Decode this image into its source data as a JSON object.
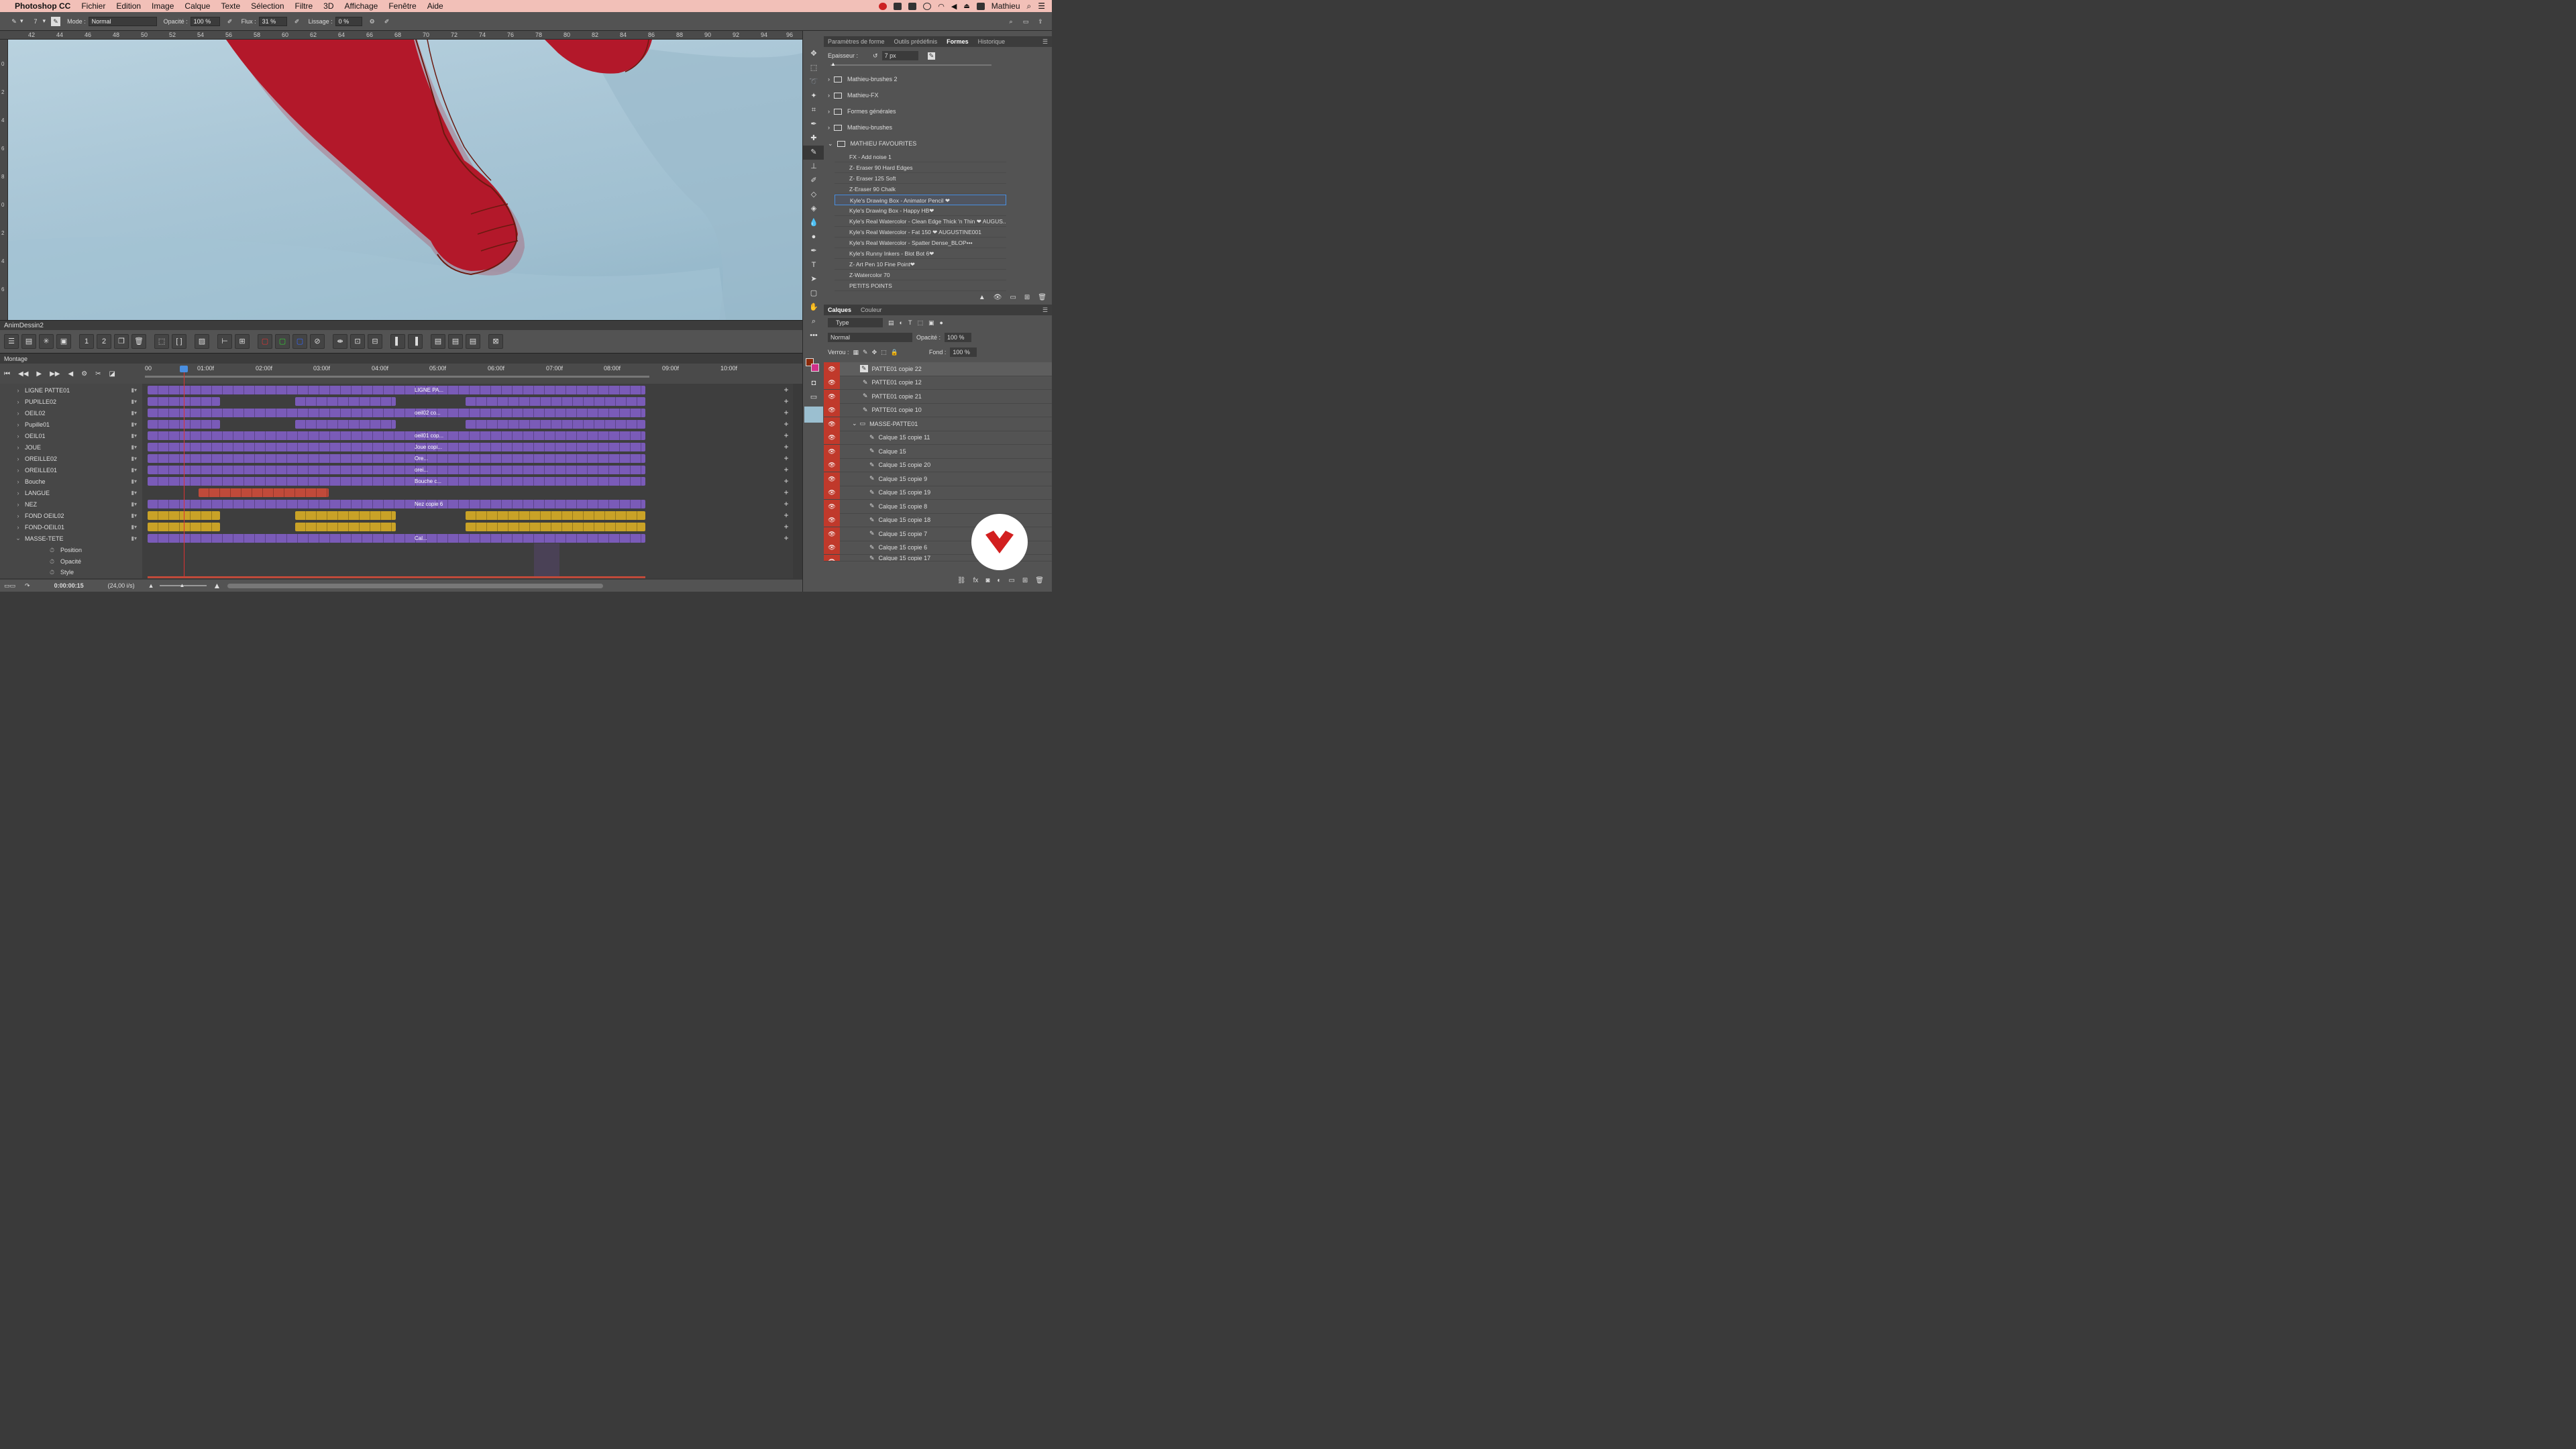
{
  "menubar": {
    "app": "Photoshop CC",
    "items": [
      "Fichier",
      "Edition",
      "Image",
      "Calque",
      "Texte",
      "Sélection",
      "Filtre",
      "3D",
      "Affichage",
      "Fenêtre",
      "Aide"
    ],
    "user": "Mathieu"
  },
  "options": {
    "brush_size": "7",
    "mode_label": "Mode :",
    "mode_value": "Normal",
    "opacity_label": "Opacité :",
    "opacity_value": "100 %",
    "flow_label": "Flux :",
    "flow_value": "31 %",
    "smoothing_label": "Lissage :",
    "smoothing_value": "0 %"
  },
  "ruler": {
    "ticks": [
      "42",
      "44",
      "46",
      "48",
      "50",
      "52",
      "54",
      "56",
      "58",
      "60",
      "62",
      "64",
      "66",
      "68",
      "70",
      "72",
      "74",
      "76",
      "78",
      "80",
      "82",
      "84",
      "86",
      "88",
      "90",
      "92",
      "94",
      "96"
    ]
  },
  "vruler": {
    "ticks": [
      "0",
      "2",
      "4",
      "6",
      "8",
      "0",
      "2",
      "4",
      "6"
    ]
  },
  "anim": {
    "title": "AnimDessin2",
    "montage": "Montage",
    "timecodes": [
      "00",
      "01:00f",
      "02:00f",
      "03:00f",
      "04:00f",
      "05:00f",
      "06:00f",
      "07:00f",
      "08:00f",
      "09:00f",
      "10:00f"
    ],
    "current_time": "0:00:00:15",
    "fps": "(24,00 i/s)",
    "layers": [
      "LIGNE PATTE01",
      "PUPILLE02",
      "OEIL02",
      "Pupille01",
      "OEIL01",
      "JOUE",
      "OREILLE02",
      "OREILLE01",
      "Bouche",
      "LANGUE",
      "NEZ",
      "FOND OEIL02",
      "FOND-OEIL01",
      "MASSE-TETE"
    ],
    "props": [
      "Position",
      "Opacité",
      "Style"
    ],
    "segment_labels": {
      "ligne": "LIGNE PA...",
      "oeil02": "oeil02 co...",
      "oeil01": "oeil01 cop...",
      "joue": "Joue copi...",
      "oreille02": "Ore...",
      "oreille01": "orei...",
      "bouche": "Bouche c...",
      "nez": "Nez copie 6",
      "masse": "Cal..."
    }
  },
  "right": {
    "tabs": [
      "Paramètres de forme",
      "Outils prédéfinis",
      "Formes",
      "Historique"
    ],
    "active_tab": "Formes",
    "thickness_label": "Epaisseur :",
    "thickness_value": "7 px",
    "folders": [
      "Mathieu-brushes 2",
      "Mathieu-FX",
      "Formes générales",
      "Mathieu-brushes",
      "MATHIEU FAVOURITES"
    ],
    "brushes": [
      "FX - Add noise 1",
      "Z- Eraser 90 Hard Edges",
      "Z- Eraser 125 Soft",
      "Z-Eraser 90 Chalk",
      "Kyle's Drawing Box - Animator Pencil ❤",
      "Kyle's Drawing Box - Happy HB❤",
      "Kyle's Real Watercolor - Clean Edge Thick 'n Thin ❤ AUGUS...",
      "Kyle's Real Watercolor - Fat 150 ❤ AUGUSTINE001",
      "Kyle's Real Watercolor - Spatter Dense_BLOP•••",
      "Kyle's Runny Inkers - Blot Bot 6❤",
      "Z- Art Pen 10 Fine Point❤",
      "Z-Watercolor 70",
      "PETITS POINTS"
    ],
    "selected_brush_index": 4,
    "layers_tabs": [
      "Calques",
      "Couleur"
    ],
    "type_filter": "Type",
    "blend_mode": "Normal",
    "opacity_label": "Opacité :",
    "opacity_value": "100 %",
    "lock_label": "Verrou :",
    "fill_label": "Fond :",
    "fill_value": "100 %",
    "layers": [
      "PATTE01 copie 22",
      "PATTE01 copie 12",
      "PATTE01 copie 21",
      "PATTE01 copie 10",
      "MASSE-PATTE01",
      "Calque 15 copie 11",
      "Calque 15",
      "Calque 15 copie 20",
      "Calque 15 copie 9",
      "Calque 15 copie 19",
      "Calque 15 copie 8",
      "Calque 15 copie 18",
      "Calque 15 copie 7",
      "Calque 15 copie 6",
      "Calque 15 copie 17"
    ]
  },
  "colors": {
    "menubar": "#f2c0b8",
    "accent_purple": "#7a5bb8",
    "accent_gold": "#c9a227",
    "accent_red": "#c04a3a",
    "eye_red": "#c0392b",
    "drawing_red": "#b3182a"
  }
}
